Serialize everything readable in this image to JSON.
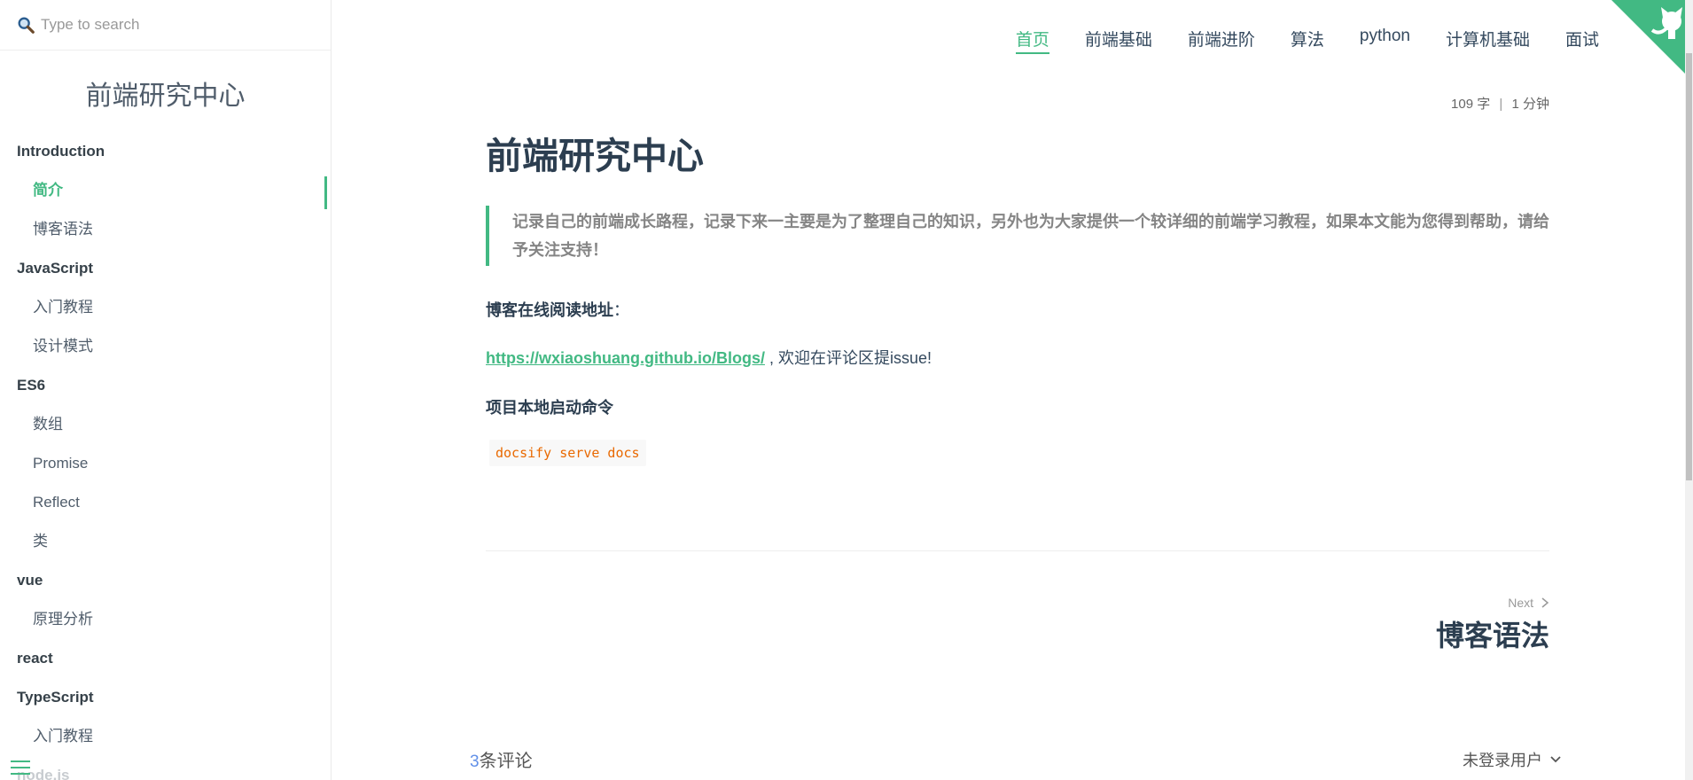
{
  "search": {
    "placeholder": "Type to search"
  },
  "sidebar": {
    "title": "前端研究中心",
    "groups": [
      {
        "title": "Introduction",
        "items": [
          "简介",
          "博客语法"
        ]
      },
      {
        "title": "JavaScript",
        "items": [
          "入门教程",
          "设计模式"
        ]
      },
      {
        "title": "ES6",
        "items": [
          "数组",
          "Promise",
          "Reflect",
          "类"
        ]
      },
      {
        "title": "vue",
        "items": [
          "原理分析"
        ]
      },
      {
        "title": "react",
        "items": []
      },
      {
        "title": "TypeScript",
        "items": [
          "入门教程"
        ]
      },
      {
        "title": "node.js",
        "items": []
      }
    ],
    "active_item": "简介"
  },
  "nav": {
    "items": [
      "首页",
      "前端基础",
      "前端进阶",
      "算法",
      "python",
      "计算机基础",
      "面试"
    ],
    "active": "首页"
  },
  "meta": {
    "words": "109 字",
    "separator": "|",
    "time": "1 分钟"
  },
  "article": {
    "title": "前端研究中心",
    "quote": "记录自己的前端成长路程，记录下来一主要是为了整理自己的知识，另外也为大家提供一个较详细的前端学习教程，如果本文能为您得到帮助，请给予关注支持！",
    "online_label": "博客在线阅读地址",
    "online_colon": "：",
    "link": "https://wxiaoshuang.github.io/Blogs/",
    "link_suffix": " , 欢迎在评论区提issue!",
    "start_label": "项目本地启动命令",
    "code": "docsify serve docs"
  },
  "pagination": {
    "next_label": "Next",
    "next_title": "博客语法"
  },
  "comments": {
    "count": "3",
    "label": "条评论",
    "user": "未登录用户"
  },
  "colors": {
    "accent": "#42b983",
    "text": "#34495e",
    "code": "#e96900"
  }
}
